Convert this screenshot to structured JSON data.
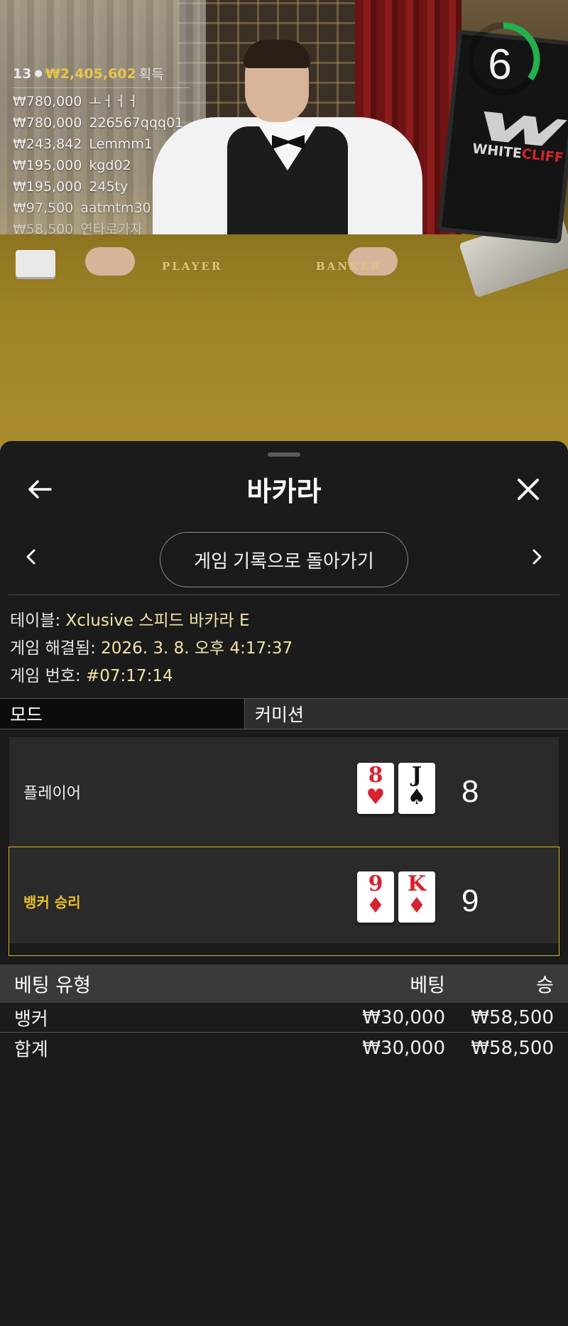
{
  "video": {
    "felt_player": "PLAYER",
    "felt_banker": "BANKER",
    "timer": "6",
    "timer_fraction": 0.35,
    "brand_white": "WHITE",
    "brand_red": "CLIFF",
    "winners": {
      "count": "13",
      "total": "₩2,405,602",
      "earn_label": "획득",
      "rows": [
        {
          "amount": "₩780,000",
          "name": "ㅗㅓㅓㅓ"
        },
        {
          "amount": "₩780,000",
          "name": "226567qqq01"
        },
        {
          "amount": "₩243,842",
          "name": "Lemmm1"
        },
        {
          "amount": "₩195,000",
          "name": "kgd02"
        },
        {
          "amount": "₩195,000",
          "name": "245ty"
        },
        {
          "amount": "₩97,500",
          "name": "aatmtm30"
        },
        {
          "amount": "₩58,500",
          "name": "연타로가자"
        }
      ]
    }
  },
  "sheet": {
    "title": "바카라",
    "back_to_history": "게임 기록으로 돌아가기",
    "table_label": "테이블: ",
    "table_value": "Xclusive 스피드 바카라 E",
    "resolved_label": "게임 해결됨: ",
    "resolved_value": "2026. 3. 8. 오후 4:17:37",
    "game_no_label": "게임 번호: ",
    "game_no_value": "#07:17:14",
    "tabs": {
      "mode": "모드",
      "commission": "커미션"
    },
    "player": {
      "label": "플레이어",
      "cards": [
        {
          "rank": "8",
          "suit": "♥",
          "color": "red"
        },
        {
          "rank": "J",
          "suit": "♠",
          "color": "black"
        }
      ],
      "score": "8"
    },
    "banker": {
      "label": "뱅커 승리",
      "cards": [
        {
          "rank": "9",
          "suit": "♦",
          "color": "red"
        },
        {
          "rank": "K",
          "suit": "♦",
          "color": "red"
        }
      ],
      "score": "9"
    },
    "bets": {
      "header": {
        "type": "베팅 유형",
        "bet": "베팅",
        "win": "승"
      },
      "rows": [
        {
          "type": "뱅커",
          "bet": "₩30,000",
          "win": "₩58,500"
        }
      ],
      "total": {
        "type": "합계",
        "bet": "₩30,000",
        "win": "₩58,500"
      }
    }
  },
  "colors": {
    "accent_gold": "#e9c54b",
    "win_border": "#d8b51f",
    "timer_green": "#22b14c"
  },
  "icons": [
    "back-arrow-icon",
    "close-icon",
    "chevron-left-icon",
    "chevron-right-icon",
    "person-icon"
  ]
}
